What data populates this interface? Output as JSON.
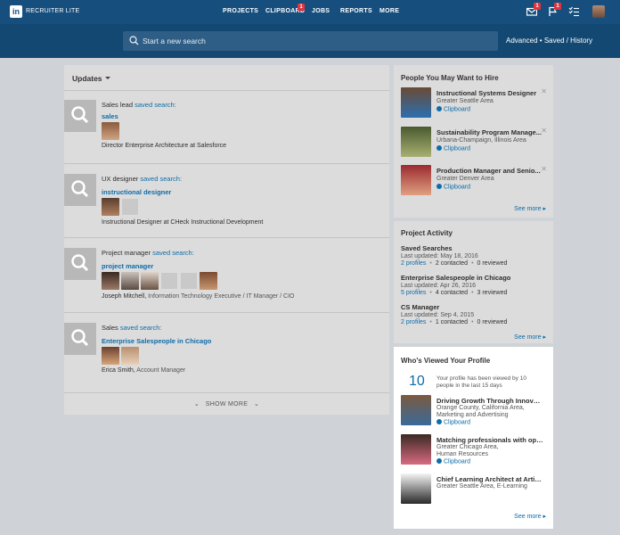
{
  "topbar": {
    "logo": "in",
    "brand": "RECRUITER LITE",
    "nav": [
      "PROJECTS",
      "CLIPBOARD",
      "JOBS",
      "REPORTS",
      "MORE"
    ],
    "clipboard_badge": "1",
    "messages_badge": "1",
    "notifications_badge": "1"
  },
  "search": {
    "placeholder": "Start a new search",
    "advanced_link": "Advanced • Saved / History"
  },
  "updates": {
    "header": "Updates",
    "items": [
      {
        "title": "Sales lead",
        "saved": "saved search:",
        "term": "sales",
        "who": "Director Enterprise Architecture at Salesforce",
        "who_extra": ""
      },
      {
        "title": "UX designer",
        "saved": "saved search:",
        "term": "instructional designer",
        "who": "Instructional Designer at CHeck Instructional Development",
        "who_extra": ""
      },
      {
        "title": "Project manager",
        "saved": "saved search:",
        "term": "project manager",
        "who": "Joseph Mitchell,",
        "who_extra": "Information Technology Executive / IT Manager / CIO"
      },
      {
        "title": "Sales",
        "saved": "saved search:",
        "term": "Enterprise Salespeople in Chicago",
        "who": "Erica Smith,",
        "who_extra": "Account Manager"
      }
    ],
    "show_more": "SHOW MORE"
  },
  "hire": {
    "title": "People You May Want to Hire",
    "people": [
      {
        "name": "Instructional Systems Designer",
        "line1": "Greater Seattle Area",
        "clip": "Clipboard"
      },
      {
        "name": "Sustainability Program Manage...",
        "line1": "Urbana-Champaign, Illinois Area",
        "clip": "Clipboard"
      },
      {
        "name": "Production Manager and Senio...",
        "line1": "Greater Denver Area",
        "clip": "Clipboard"
      }
    ],
    "see_more": "See more"
  },
  "activity": {
    "title": "Project Activity",
    "projects": [
      {
        "name": "Saved Searches",
        "updated": "Last updated: May 18, 2016",
        "profiles": "2 profiles",
        "contacted": "2 contacted",
        "reviewed": "0 reviewed"
      },
      {
        "name": "Enterprise Salespeople in Chicago",
        "updated": "Last updated: Apr 26, 2016",
        "profiles": "5 profiles",
        "contacted": "4 contacted",
        "reviewed": "3 reviewed"
      },
      {
        "name": "CS Manager",
        "updated": "Last updated: Sep 4, 2015",
        "profiles": "2 profiles",
        "contacted": "1 contacted",
        "reviewed": "0 reviewed"
      }
    ],
    "see_more": "See more"
  },
  "viewed": {
    "title": "Who's Viewed Your Profile",
    "count": "10",
    "text": "Your profile has been viewed by 10 people in the last 15 days",
    "people": [
      {
        "name": "Driving Growth Through Innovati...",
        "line1": "Orange County, California Area,",
        "line2": "Marketing and Advertising",
        "clip": "Clipboard"
      },
      {
        "name": "Matching professionals with opp...",
        "line1": "Greater Chicago Area,",
        "line2": "Human Resources",
        "clip": "Clipboard"
      },
      {
        "name": "Chief Learning Architect at Artic...",
        "line1": "Greater Seattle Area, E-Learning",
        "line2": "",
        "clip": ""
      }
    ],
    "see_more": "See more"
  }
}
